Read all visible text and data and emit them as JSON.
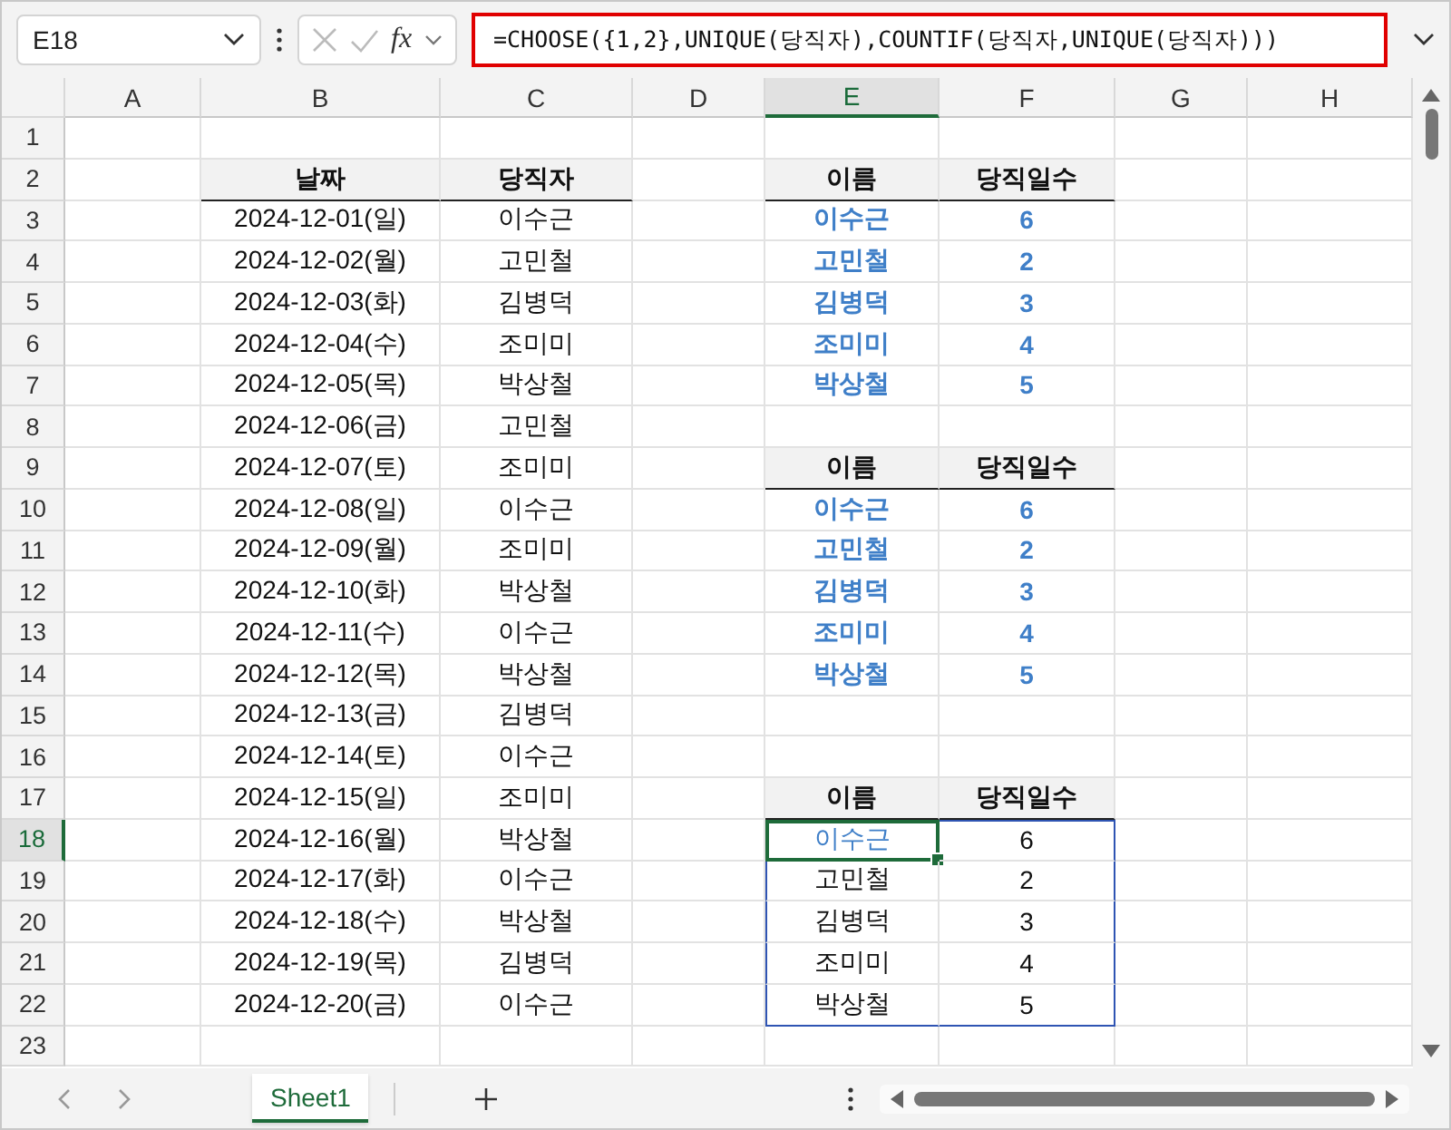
{
  "formula_bar": {
    "name_box": "E18",
    "fx": "fx",
    "formula": "=CHOOSE({1,2},UNIQUE(당직자),COUNTIF(당직자,UNIQUE(당직자)))"
  },
  "columns": [
    {
      "label": "A",
      "selected": false
    },
    {
      "label": "B",
      "selected": false
    },
    {
      "label": "C",
      "selected": false
    },
    {
      "label": "D",
      "selected": false
    },
    {
      "label": "E",
      "selected": true
    },
    {
      "label": "F",
      "selected": false
    },
    {
      "label": "G",
      "selected": false
    },
    {
      "label": "H",
      "selected": false
    }
  ],
  "rows": [
    {
      "label": "1",
      "selected": false,
      "cells": {}
    },
    {
      "label": "2",
      "selected": false,
      "cells": {
        "B": {
          "text": "날짜",
          "kind": "header",
          "selected": false,
          "spill": false
        },
        "C": {
          "text": "당직자",
          "kind": "header",
          "selected": false,
          "spill": false
        },
        "E": {
          "text": "이름",
          "kind": "header",
          "selected": false,
          "spill": false
        },
        "F": {
          "text": "당직일수",
          "kind": "header",
          "selected": false,
          "spill": false
        }
      }
    },
    {
      "label": "3",
      "selected": false,
      "cells": {
        "B": {
          "text": "2024-12-01(일)",
          "kind": "plain",
          "selected": false,
          "spill": false
        },
        "C": {
          "text": "이수근",
          "kind": "plain",
          "selected": false,
          "spill": false
        },
        "E": {
          "text": "이수근",
          "kind": "result",
          "selected": false,
          "spill": false
        },
        "F": {
          "text": "6",
          "kind": "result",
          "selected": false,
          "spill": false
        }
      }
    },
    {
      "label": "4",
      "selected": false,
      "cells": {
        "B": {
          "text": "2024-12-02(월)",
          "kind": "plain",
          "selected": false,
          "spill": false
        },
        "C": {
          "text": "고민철",
          "kind": "plain",
          "selected": false,
          "spill": false
        },
        "E": {
          "text": "고민철",
          "kind": "result",
          "selected": false,
          "spill": false
        },
        "F": {
          "text": "2",
          "kind": "result",
          "selected": false,
          "spill": false
        }
      }
    },
    {
      "label": "5",
      "selected": false,
      "cells": {
        "B": {
          "text": "2024-12-03(화)",
          "kind": "plain",
          "selected": false,
          "spill": false
        },
        "C": {
          "text": "김병덕",
          "kind": "plain",
          "selected": false,
          "spill": false
        },
        "E": {
          "text": "김병덕",
          "kind": "result",
          "selected": false,
          "spill": false
        },
        "F": {
          "text": "3",
          "kind": "result",
          "selected": false,
          "spill": false
        }
      }
    },
    {
      "label": "6",
      "selected": false,
      "cells": {
        "B": {
          "text": "2024-12-04(수)",
          "kind": "plain",
          "selected": false,
          "spill": false
        },
        "C": {
          "text": "조미미",
          "kind": "plain",
          "selected": false,
          "spill": false
        },
        "E": {
          "text": "조미미",
          "kind": "result",
          "selected": false,
          "spill": false
        },
        "F": {
          "text": "4",
          "kind": "result",
          "selected": false,
          "spill": false
        }
      }
    },
    {
      "label": "7",
      "selected": false,
      "cells": {
        "B": {
          "text": "2024-12-05(목)",
          "kind": "plain",
          "selected": false,
          "spill": false
        },
        "C": {
          "text": "박상철",
          "kind": "plain",
          "selected": false,
          "spill": false
        },
        "E": {
          "text": "박상철",
          "kind": "result",
          "selected": false,
          "spill": false
        },
        "F": {
          "text": "5",
          "kind": "result",
          "selected": false,
          "spill": false
        }
      }
    },
    {
      "label": "8",
      "selected": false,
      "cells": {
        "B": {
          "text": "2024-12-06(금)",
          "kind": "plain",
          "selected": false,
          "spill": false
        },
        "C": {
          "text": "고민철",
          "kind": "plain",
          "selected": false,
          "spill": false
        }
      }
    },
    {
      "label": "9",
      "selected": false,
      "cells": {
        "B": {
          "text": "2024-12-07(토)",
          "kind": "plain",
          "selected": false,
          "spill": false
        },
        "C": {
          "text": "조미미",
          "kind": "plain",
          "selected": false,
          "spill": false
        },
        "E": {
          "text": "이름",
          "kind": "header",
          "selected": false,
          "spill": false
        },
        "F": {
          "text": "당직일수",
          "kind": "header",
          "selected": false,
          "spill": false
        }
      }
    },
    {
      "label": "10",
      "selected": false,
      "cells": {
        "B": {
          "text": "2024-12-08(일)",
          "kind": "plain",
          "selected": false,
          "spill": false
        },
        "C": {
          "text": "이수근",
          "kind": "plain",
          "selected": false,
          "spill": false
        },
        "E": {
          "text": "이수근",
          "kind": "result",
          "selected": false,
          "spill": false
        },
        "F": {
          "text": "6",
          "kind": "result",
          "selected": false,
          "spill": false
        }
      }
    },
    {
      "label": "11",
      "selected": false,
      "cells": {
        "B": {
          "text": "2024-12-09(월)",
          "kind": "plain",
          "selected": false,
          "spill": false
        },
        "C": {
          "text": "조미미",
          "kind": "plain",
          "selected": false,
          "spill": false
        },
        "E": {
          "text": "고민철",
          "kind": "result",
          "selected": false,
          "spill": false
        },
        "F": {
          "text": "2",
          "kind": "result",
          "selected": false,
          "spill": false
        }
      }
    },
    {
      "label": "12",
      "selected": false,
      "cells": {
        "B": {
          "text": "2024-12-10(화)",
          "kind": "plain",
          "selected": false,
          "spill": false
        },
        "C": {
          "text": "박상철",
          "kind": "plain",
          "selected": false,
          "spill": false
        },
        "E": {
          "text": "김병덕",
          "kind": "result",
          "selected": false,
          "spill": false
        },
        "F": {
          "text": "3",
          "kind": "result",
          "selected": false,
          "spill": false
        }
      }
    },
    {
      "label": "13",
      "selected": false,
      "cells": {
        "B": {
          "text": "2024-12-11(수)",
          "kind": "plain",
          "selected": false,
          "spill": false
        },
        "C": {
          "text": "이수근",
          "kind": "plain",
          "selected": false,
          "spill": false
        },
        "E": {
          "text": "조미미",
          "kind": "result",
          "selected": false,
          "spill": false
        },
        "F": {
          "text": "4",
          "kind": "result",
          "selected": false,
          "spill": false
        }
      }
    },
    {
      "label": "14",
      "selected": false,
      "cells": {
        "B": {
          "text": "2024-12-12(목)",
          "kind": "plain",
          "selected": false,
          "spill": false
        },
        "C": {
          "text": "박상철",
          "kind": "plain",
          "selected": false,
          "spill": false
        },
        "E": {
          "text": "박상철",
          "kind": "result",
          "selected": false,
          "spill": false
        },
        "F": {
          "text": "5",
          "kind": "result",
          "selected": false,
          "spill": false
        }
      }
    },
    {
      "label": "15",
      "selected": false,
      "cells": {
        "B": {
          "text": "2024-12-13(금)",
          "kind": "plain",
          "selected": false,
          "spill": false
        },
        "C": {
          "text": "김병덕",
          "kind": "plain",
          "selected": false,
          "spill": false
        }
      }
    },
    {
      "label": "16",
      "selected": false,
      "cells": {
        "B": {
          "text": "2024-12-14(토)",
          "kind": "plain",
          "selected": false,
          "spill": false
        },
        "C": {
          "text": "이수근",
          "kind": "plain",
          "selected": false,
          "spill": false
        }
      }
    },
    {
      "label": "17",
      "selected": false,
      "cells": {
        "B": {
          "text": "2024-12-15(일)",
          "kind": "plain",
          "selected": false,
          "spill": false
        },
        "C": {
          "text": "조미미",
          "kind": "plain",
          "selected": false,
          "spill": false
        },
        "E": {
          "text": "이름",
          "kind": "header",
          "selected": false,
          "spill": false
        },
        "F": {
          "text": "당직일수",
          "kind": "header",
          "selected": false,
          "spill": false
        }
      }
    },
    {
      "label": "18",
      "selected": true,
      "cells": {
        "B": {
          "text": "2024-12-16(월)",
          "kind": "plain",
          "selected": false,
          "spill": false
        },
        "C": {
          "text": "박상철",
          "kind": "plain",
          "selected": false,
          "spill": false
        },
        "E": {
          "text": "이수근",
          "kind": "highlight",
          "selected": true,
          "spill": true
        },
        "F": {
          "text": "6",
          "kind": "plain",
          "selected": false,
          "spill": true
        }
      }
    },
    {
      "label": "19",
      "selected": false,
      "cells": {
        "B": {
          "text": "2024-12-17(화)",
          "kind": "plain",
          "selected": false,
          "spill": false
        },
        "C": {
          "text": "이수근",
          "kind": "plain",
          "selected": false,
          "spill": false
        },
        "E": {
          "text": "고민철",
          "kind": "plain",
          "selected": false,
          "spill": true
        },
        "F": {
          "text": "2",
          "kind": "plain",
          "selected": false,
          "spill": true
        }
      }
    },
    {
      "label": "20",
      "selected": false,
      "cells": {
        "B": {
          "text": "2024-12-18(수)",
          "kind": "plain",
          "selected": false,
          "spill": false
        },
        "C": {
          "text": "박상철",
          "kind": "plain",
          "selected": false,
          "spill": false
        },
        "E": {
          "text": "김병덕",
          "kind": "plain",
          "selected": false,
          "spill": true
        },
        "F": {
          "text": "3",
          "kind": "plain",
          "selected": false,
          "spill": true
        }
      }
    },
    {
      "label": "21",
      "selected": false,
      "cells": {
        "B": {
          "text": "2024-12-19(목)",
          "kind": "plain",
          "selected": false,
          "spill": false
        },
        "C": {
          "text": "김병덕",
          "kind": "plain",
          "selected": false,
          "spill": false
        },
        "E": {
          "text": "조미미",
          "kind": "plain",
          "selected": false,
          "spill": true
        },
        "F": {
          "text": "4",
          "kind": "plain",
          "selected": false,
          "spill": true
        }
      }
    },
    {
      "label": "22",
      "selected": false,
      "cells": {
        "B": {
          "text": "2024-12-20(금)",
          "kind": "plain",
          "selected": false,
          "spill": false
        },
        "C": {
          "text": "이수근",
          "kind": "plain",
          "selected": false,
          "spill": false
        },
        "E": {
          "text": "박상철",
          "kind": "plain",
          "selected": false,
          "spill": true
        },
        "F": {
          "text": "5",
          "kind": "plain",
          "selected": false,
          "spill": true
        }
      }
    },
    {
      "label": "23",
      "selected": false,
      "cells": {}
    }
  ],
  "sheet_tabs": [
    {
      "label": "Sheet1",
      "selected": true
    }
  ]
}
